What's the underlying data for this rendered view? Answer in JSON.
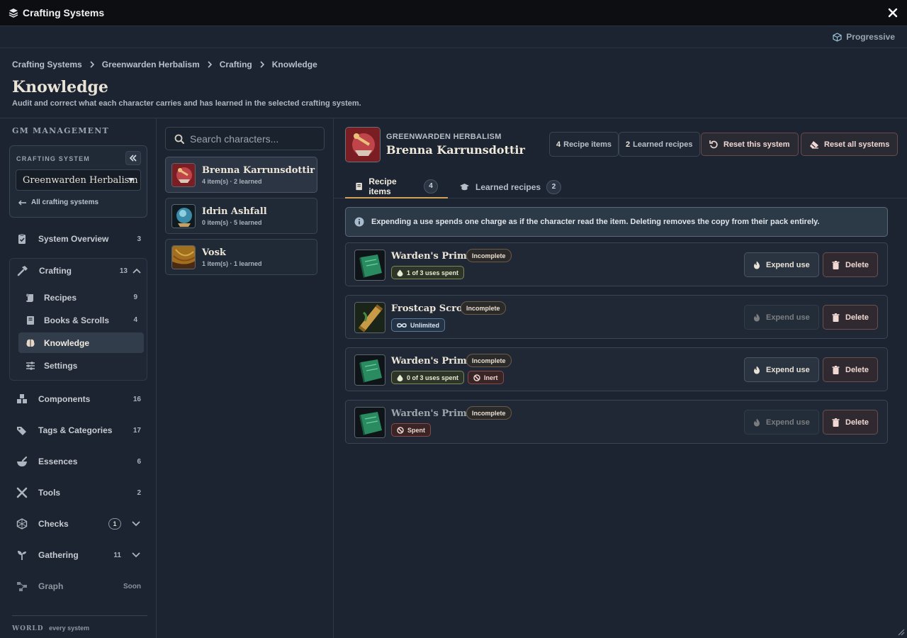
{
  "window": {
    "title": "Crafting Systems",
    "mode": "Progressive"
  },
  "breadcrumb": [
    "Crafting Systems",
    "Greenwarden Herbalism",
    "Crafting",
    "Knowledge"
  ],
  "page": {
    "title": "Knowledge",
    "subtitle": "Audit and correct what each character carries and has learned in the selected crafting system."
  },
  "sidebar": {
    "section_label": "GM MANAGEMENT",
    "crafting_system_label": "CRAFTING SYSTEM",
    "selected_system": "Greenwarden Herbalism",
    "back_link": "All crafting systems",
    "items": [
      {
        "label": "System Overview",
        "count": "3"
      },
      {
        "label": "Crafting",
        "count": "13"
      },
      {
        "label": "Components",
        "count": "16"
      },
      {
        "label": "Tags & Categories",
        "count": "17"
      },
      {
        "label": "Essences",
        "count": "6"
      },
      {
        "label": "Tools",
        "count": "2"
      },
      {
        "label": "Checks",
        "count": "1"
      },
      {
        "label": "Gathering",
        "count": "11"
      },
      {
        "label": "Graph",
        "count": "Soon"
      }
    ],
    "crafting_sub": [
      {
        "label": "Recipes",
        "count": "9"
      },
      {
        "label": "Books & Scrolls",
        "count": "4"
      },
      {
        "label": "Knowledge",
        "count": ""
      },
      {
        "label": "Settings",
        "count": ""
      }
    ],
    "world_label": "WORLD",
    "world_sub": "every system"
  },
  "characters": {
    "search_placeholder": "Search characters...",
    "list": [
      {
        "name": "Brenna Karrunsdottir",
        "meta": "4 item(s) · 2 learned"
      },
      {
        "name": "Idrin Ashfall",
        "meta": "0 item(s) · 5 learned"
      },
      {
        "name": "Vosk",
        "meta": "1 item(s) · 1 learned"
      }
    ]
  },
  "detail": {
    "system": "GREENWARDEN HERBALISM",
    "character": "Brenna Karrunsdottir",
    "recipe_items_count": "4",
    "recipe_items_label": "Recipe items",
    "learned_count": "2",
    "learned_label": "Learned recipes",
    "reset_this": "Reset this system",
    "reset_all": "Reset all systems",
    "tabs": [
      {
        "label": "Recipe items",
        "count": "4"
      },
      {
        "label": "Learned recipes",
        "count": "2"
      }
    ],
    "info": "Expending a use spends one charge as if the character read the item. Deleting removes the copy from their pack entirely.",
    "expend_label": "Expend use",
    "delete_label": "Delete",
    "items": [
      {
        "name": "Warden's Primer",
        "status": "Incomplete",
        "tag": "1 of 3 uses spent",
        "tag2": ""
      },
      {
        "name": "Frostcap Scroll",
        "status": "Incomplete",
        "tag": "Unlimited",
        "tag2": ""
      },
      {
        "name": "Warden's Primer",
        "status": "Incomplete",
        "tag": "0 of 3 uses spent",
        "tag2": "Inert"
      },
      {
        "name": "Warden's Primer",
        "status": "Incomplete",
        "tag": "Spent",
        "tag2": ""
      }
    ]
  },
  "colors": {
    "accent": "#d1a35a",
    "background": "#1b2430",
    "titlebar": "#0c0e12"
  }
}
